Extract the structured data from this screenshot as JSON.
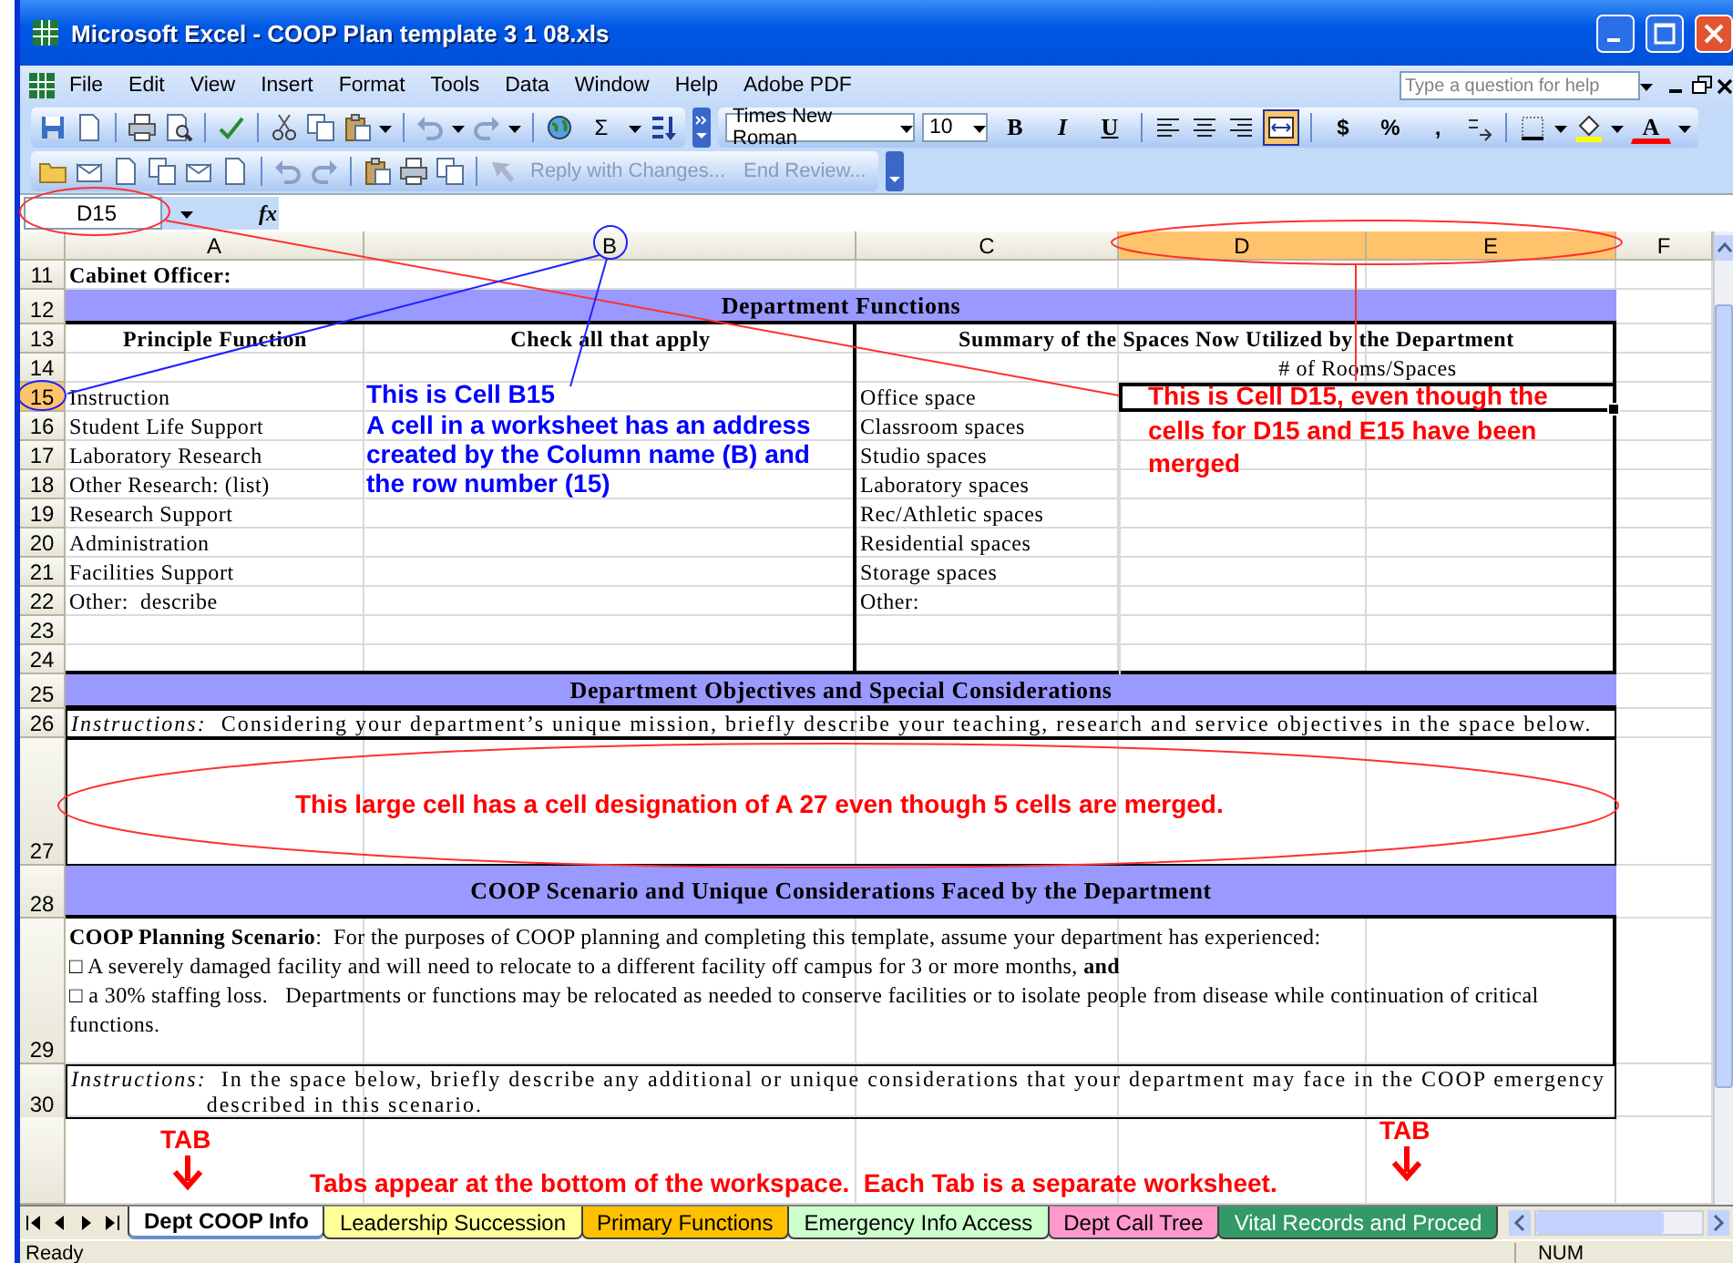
{
  "window": {
    "title": "Microsoft Excel - COOP Plan template 3 1 08.xls"
  },
  "menu": {
    "items": [
      "File",
      "Edit",
      "View",
      "Insert",
      "Format",
      "Tools",
      "Data",
      "Window",
      "Help",
      "Adobe PDF"
    ],
    "help_search": {
      "placeholder": "Type a question for help"
    }
  },
  "standard_toolbar": {
    "autosum": "Σ"
  },
  "formatting_toolbar": {
    "font": "Times New Roman",
    "size": "10",
    "style_buttons": [
      "B",
      "I",
      "U"
    ],
    "merge_and_center": {
      "selected": true
    },
    "number_buttons": [
      "$",
      "%",
      ","
    ],
    "font_color_label": "A"
  },
  "reviewing_toolbar": {
    "buttons": [
      {
        "label": "Reply with Changes...",
        "disabled": true
      },
      {
        "label": "End Review...",
        "disabled": true
      }
    ]
  },
  "formula_bar": {
    "name_box": "D15",
    "function_label": "fx"
  },
  "columns": [
    {
      "label": "A",
      "selected": false
    },
    {
      "label": "B",
      "selected": false
    },
    {
      "label": "C",
      "selected": false
    },
    {
      "label": "D",
      "selected": true
    },
    {
      "label": "E",
      "selected": true
    },
    {
      "label": "F",
      "selected": false
    }
  ],
  "rows": [
    {
      "number": "11",
      "selected": false,
      "kind": "label",
      "text": "Cabinet Officer:"
    },
    {
      "number": "12",
      "selected": false,
      "kind": "banner",
      "text": "Department Functions"
    },
    {
      "number": "13",
      "selected": false,
      "kind": "headers",
      "texts": [
        "Principle Function",
        "Check all that apply",
        "Summary of the Spaces Now Utilized by the Department"
      ]
    },
    {
      "number": "14",
      "selected": false,
      "kind": "subheader",
      "text": "# of Rooms/Spaces"
    },
    {
      "number": "15",
      "selected": true,
      "kind": "item",
      "function": "Instruction",
      "space": "Office space",
      "count_selected": true
    },
    {
      "number": "16",
      "selected": false,
      "kind": "item",
      "function": "Student Life Support",
      "space": "Classroom spaces",
      "count_selected": false
    },
    {
      "number": "17",
      "selected": false,
      "kind": "item",
      "function": "Laboratory Research",
      "space": "Studio spaces",
      "count_selected": false
    },
    {
      "number": "18",
      "selected": false,
      "kind": "item",
      "function": "Other Research: (list)",
      "space": "Laboratory spaces",
      "count_selected": false
    },
    {
      "number": "19",
      "selected": false,
      "kind": "item",
      "function": "Research Support",
      "space": "Rec/Athletic spaces",
      "count_selected": false
    },
    {
      "number": "20",
      "selected": false,
      "kind": "item",
      "function": "Administration",
      "space": "Residential spaces",
      "count_selected": false
    },
    {
      "number": "21",
      "selected": false,
      "kind": "item",
      "function": "Facilities Support",
      "space": "Storage spaces",
      "count_selected": false
    },
    {
      "number": "22",
      "selected": false,
      "kind": "item",
      "function": "Other:  describe",
      "space": "Other:",
      "count_selected": false
    },
    {
      "number": "23",
      "selected": false,
      "kind": "item",
      "count_selected": false
    },
    {
      "number": "24",
      "selected": false,
      "kind": "item",
      "count_selected": false
    },
    {
      "number": "25",
      "selected": false,
      "kind": "banner",
      "text": "Department Objectives and Special Considerations"
    },
    {
      "number": "26",
      "selected": false,
      "kind": "instruction",
      "text": "*Instructions:*  Considering your department’s unique mission, briefly describe your teaching, research and service objectives in the space below."
    },
    {
      "number": "27",
      "selected": false,
      "kind": "large"
    },
    {
      "number": "28",
      "selected": false,
      "kind": "banner",
      "text": "COOP Scenario and Unique Considerations Faced by the Department"
    },
    {
      "number": "29",
      "selected": false,
      "kind": "paragraphs",
      "paragraphs": [
        "**COOP Planning Scenario**:  For the purposes of COOP planning and completing this template, assume your department has experienced:",
        "□ A severely damaged facility and will need to relocate to a different facility off campus for 3 or more months, **and**",
        "□ a 30% staffing loss.   Departments or functions may be relocated as needed to conserve facilities or to isolate people from disease while continuation of critical functions."
      ]
    },
    {
      "number": "30",
      "selected": false,
      "kind": "instruction",
      "text": "*Instructions:*  In the space below, briefly describe any additional or unique considerations that your department may face in the COOP emergency described in this scenario."
    },
    {
      "selected": false,
      "kind": "blank"
    }
  ],
  "annotations": [
    {
      "text": "This is Cell B15",
      "color": "#0000ff"
    },
    {
      "text": "A cell in a worksheet has an address created by the Column name (B) and the row number (15)",
      "color": "#0000ff"
    },
    {
      "text": "This is Cell D15, even though the cells for D15 and E15 have been merged",
      "color": "#ff0000"
    },
    {
      "text": "This large cell has a cell designation of A 27 even though 5 cells are merged.",
      "color": "#ff0000"
    },
    {
      "text": "TAB",
      "color": "#ff0000"
    },
    {
      "text": "TAB",
      "color": "#ff0000"
    },
    {
      "text": "Tabs appear at the bottom of the workspace.  Each Tab is a separate worksheet.",
      "color": "#ff0000"
    }
  ],
  "sheet_tabs": [
    {
      "label": "Dept COOP Info",
      "selected": true,
      "color": "#ffffff"
    },
    {
      "label": "Leadership Succession",
      "selected": false,
      "color": "#ffff99"
    },
    {
      "label": "Primary Functions",
      "selected": false,
      "color": "#ffc000"
    },
    {
      "label": "Emergency Info Access",
      "selected": false,
      "color": "#ccffcc"
    },
    {
      "label": "Dept Call Tree",
      "selected": false,
      "color": "#ff99cc"
    },
    {
      "label": "Vital Records and Proced",
      "selected": false,
      "color": "#339966"
    }
  ],
  "status_bar": {
    "text": "Ready",
    "indicator": "NUM"
  }
}
